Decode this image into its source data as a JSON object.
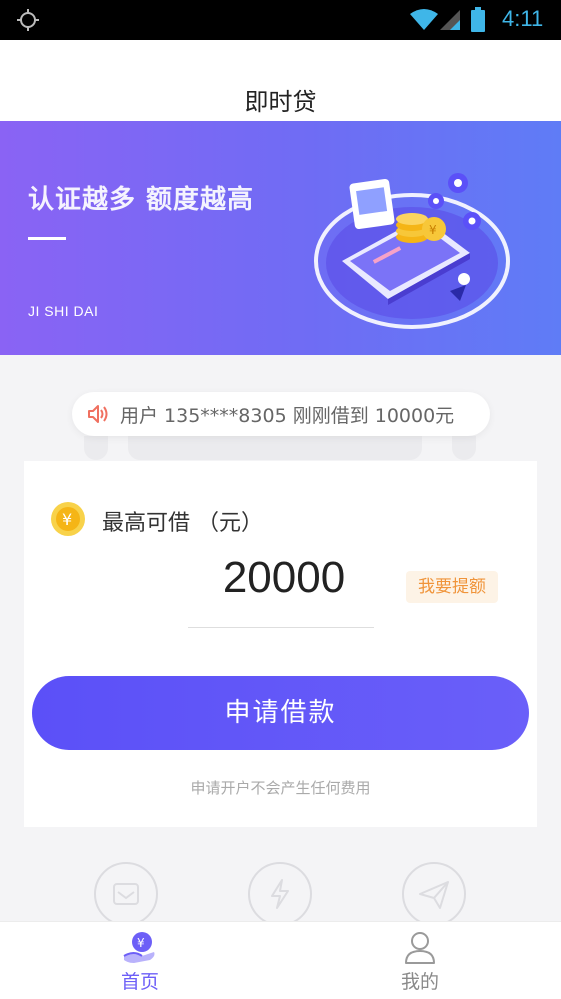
{
  "status_bar": {
    "time": "4:11"
  },
  "header": {
    "title": "即时贷"
  },
  "banner": {
    "slogan": "认证越多 额度越高",
    "brand": "JI SHI DAI"
  },
  "notice": {
    "text": "用户 135****8305 刚刚借到 10000元"
  },
  "loan_card": {
    "label": "最高可借 （元）",
    "amount": "20000",
    "raise_button": "我要提额",
    "apply_button": "申请借款",
    "note": "申请开户不会产生任何费用"
  },
  "bottom_nav": {
    "items": [
      {
        "label": "首页",
        "icon": "home-coin-icon",
        "active": true
      },
      {
        "label": "我的",
        "icon": "user-icon",
        "active": false
      }
    ]
  },
  "colors": {
    "accent": "#6d5ff7",
    "banner_start": "#8a63f4",
    "banner_end": "#5f7cf6",
    "raise_text": "#f0943a",
    "status_icons": "#3fb6e8"
  }
}
